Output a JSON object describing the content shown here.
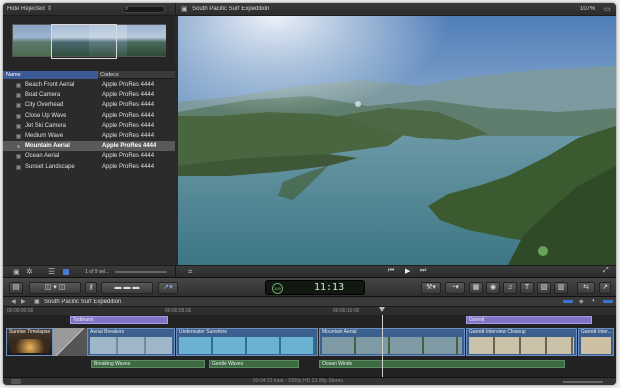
{
  "browser": {
    "filter_label": "Hide Rejected",
    "columns": {
      "name": "Name",
      "codecs": "Codecs"
    },
    "clips": [
      {
        "name": "Beach Front Aerial",
        "codec": "Apple ProRes 4444"
      },
      {
        "name": "Boat Camera",
        "codec": "Apple ProRes 4444"
      },
      {
        "name": "City Overhead",
        "codec": "Apple ProRes 4444"
      },
      {
        "name": "Close Up Wave",
        "codec": "Apple ProRes 4444"
      },
      {
        "name": "Jet Ski Camera",
        "codec": "Apple ProRes 4444"
      },
      {
        "name": "Medium Wave",
        "codec": "Apple ProRes 4444"
      },
      {
        "name": "Mountain Aerial",
        "codec": "Apple ProRes 4444",
        "selected": true
      },
      {
        "name": "Ocean Aerial",
        "codec": "Apple ProRes 4444"
      },
      {
        "name": "Sunset Landscape",
        "codec": "Apple ProRes 4444"
      }
    ],
    "selection_count": "1 of 9 sel..."
  },
  "viewer": {
    "title": "South Pacific Surf Expedition",
    "zoom": "107%"
  },
  "dashboard": {
    "percent": "100",
    "timecode": "11:13"
  },
  "timeline": {
    "project_name": "South Pacific Surf Expedition",
    "ruler": [
      "00:00:00:00",
      "00:00:05:00",
      "00:00:10:00"
    ],
    "titles": [
      "Todmann",
      "Garrett"
    ],
    "video_clips": [
      "Sunrise Timelapse",
      "Aerial Breakers",
      "Underwater Sunshine",
      "Mountain Aerial",
      "Garrett Interview Closeup",
      "Garrett Inter..."
    ],
    "audio_clips": [
      "Breaking Waves",
      "Gentle Waves",
      "Ocean Winds"
    ],
    "footer_text": "00:04:23 total - 1080p HD 23.98p Stereo"
  },
  "colors": {
    "accent": "#3c5a96",
    "title_clip": "#8173c6",
    "audio_clip": "#3e6a43",
    "video_clip": "#3b5f8e"
  }
}
